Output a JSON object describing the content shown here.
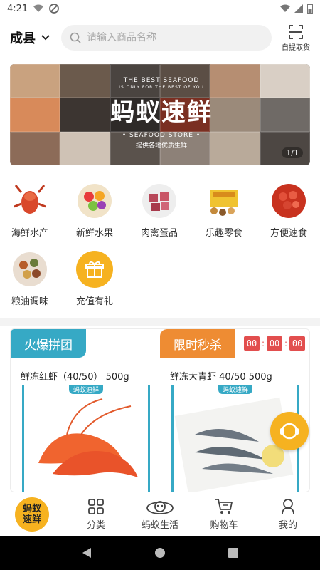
{
  "status_bar": {
    "time": "4:21"
  },
  "header": {
    "city": "成县",
    "search_placeholder": "请输入商品名称",
    "pickup_label": "自提取货"
  },
  "banner": {
    "en_line1": "THE BEST SEAFOOD",
    "en_line2": "IS ONLY FOR THE BEST OF YOU",
    "title": "蚂蚁速鲜",
    "store_line": "• SEAFOOD STORE •",
    "subtitle": "提供各地优质生鲜",
    "counter": "1/1"
  },
  "categories": [
    {
      "label": "海鲜水产",
      "icon": "lobster-icon"
    },
    {
      "label": "新鲜水果",
      "icon": "fruit-bowl-icon"
    },
    {
      "label": "肉禽蛋品",
      "icon": "meat-icon"
    },
    {
      "label": "乐趣零食",
      "icon": "snack-box-icon"
    },
    {
      "label": "方便速食",
      "icon": "crayfish-icon"
    },
    {
      "label": "粮油调味",
      "icon": "spices-icon"
    },
    {
      "label": "充值有礼",
      "icon": "gift-icon"
    }
  ],
  "promo": {
    "group_tag": "火爆拼团",
    "flash_tag": "限时秒杀",
    "timer": [
      "00",
      "00",
      "00"
    ],
    "products": [
      {
        "name": "鲜冻红虾（40/50） 500g",
        "badge": "蚂蚁速鲜"
      },
      {
        "name": "鲜冻大青虾 40/50 500g",
        "badge": "蚂蚁速鲜"
      }
    ]
  },
  "tabs": [
    {
      "label": "蚂蚁速鲜",
      "icon": "home-logo-icon"
    },
    {
      "label": "分类",
      "icon": "grid-icon"
    },
    {
      "label": "蚂蚁生活",
      "icon": "ant-life-icon"
    },
    {
      "label": "购物车",
      "icon": "cart-icon"
    },
    {
      "label": "我的",
      "icon": "profile-icon"
    }
  ],
  "colors": {
    "accent_yellow": "#f6b220",
    "group_blue": "#36a9c5",
    "flash_orange": "#ee8c33",
    "timer_red": "#e24e4e"
  }
}
